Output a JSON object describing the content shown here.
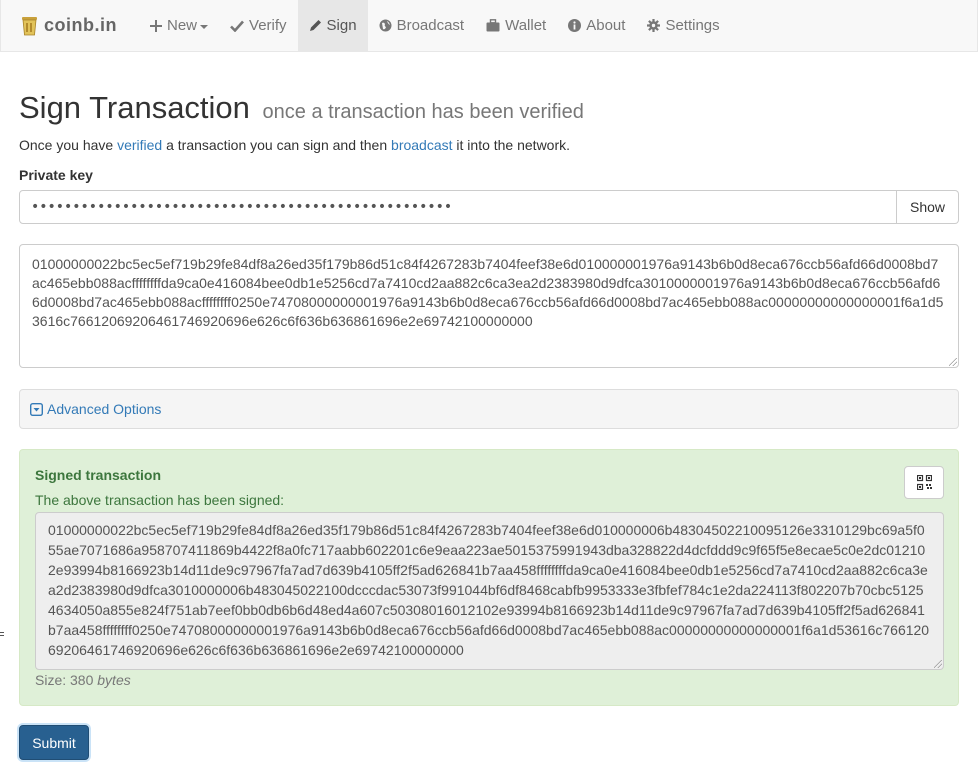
{
  "brand": {
    "name": "coinb.in"
  },
  "nav": {
    "items": [
      {
        "label": "New",
        "icon": "plus-icon"
      },
      {
        "label": "Verify",
        "icon": "check-icon"
      },
      {
        "label": "Sign",
        "icon": "pencil-icon",
        "active": true
      },
      {
        "label": "Broadcast",
        "icon": "globe-icon"
      },
      {
        "label": "Wallet",
        "icon": "briefcase-icon"
      },
      {
        "label": "About",
        "icon": "info-icon"
      },
      {
        "label": "Settings",
        "icon": "gear-icon"
      }
    ]
  },
  "header": {
    "title": "Sign Transaction",
    "subtitle": "once a transaction has been verified"
  },
  "intro": {
    "before": "Once you have ",
    "link1": "verified",
    "middle": " a transaction you can sign and then ",
    "link2": "broadcast",
    "after": " it into the network."
  },
  "private_key": {
    "label": "Private key",
    "value": "•••••••••••••••••••••••••••••••••••••••••••••••••••",
    "show_label": "Show"
  },
  "raw_transaction": "01000000022bc5ec5ef719b29fe84df8a26ed35f179b86d51c84f4267283b7404feef38e6d010000001976a9143b6b0d8eca676ccb56afd66d0008bd7ac465ebb088acffffffffda9ca0e416084bee0db1e5256cd7a7410cd2aa882c6ca3ea2d2383980d9dfca3010000001976a9143b6b0d8eca676ccb56afd66d0008bd7ac465ebb088acffffffff0250e74708000000001976a9143b6b0d8eca676ccb56afd66d0008bd7ac465ebb088ac00000000000000001f6a1d53616c76612069206461746920696e626c6f636b636861696e2e69742100000000",
  "advanced": {
    "label": "Advanced Options"
  },
  "signed": {
    "title": "Signed transaction",
    "subtitle": "The above transaction has been signed:",
    "hex": "01000000022bc5ec5ef719b29fe84df8a26ed35f179b86d51c84f4267283b7404feef38e6d010000006b48304502210095126e3310129bc69a5f055ae7071686a958707411869b4422f8a0fc717aabb602201c6e9eaa223ae5015375991943dba328822d4dcfddd9c9f65f5e8ecae5c0e2dc012102e93994b8166923b14d11de9c97967fa7ad7d639b4105ff2f5ad626841b7aa458ffffffffda9ca0e416084bee0db1e5256cd7a7410cd2aa882c6ca3ea2d2383980d9dfca3010000006b483045022100dcccdac53073f991044bf6df8468cabfb9953333e3fbfef784c1e2da224113f802207b70cbc51254634050a855e824f751ab7eef0bb0db6b6d48ed4a607c50308016012102e93994b8166923b14d11de9c97967fa7ad7d639b4105ff2f5ad626841b7aa458ffffffff0250e74708000000001976a9143b6b0d8eca676ccb56afd66d0008bd7ac465ebb088ac00000000000000001f6a1d53616c76612069206461746920696e626c6f636b636861696e2e69742100000000",
    "size_prefix": "Size: ",
    "size_value": "380",
    "size_unit": "bytes"
  },
  "submit": {
    "label": "Submit"
  },
  "colors": {
    "link": "#337ab7",
    "success_bg": "#dff0d8",
    "success_text": "#3c763d",
    "primary_btn": "#286090"
  }
}
